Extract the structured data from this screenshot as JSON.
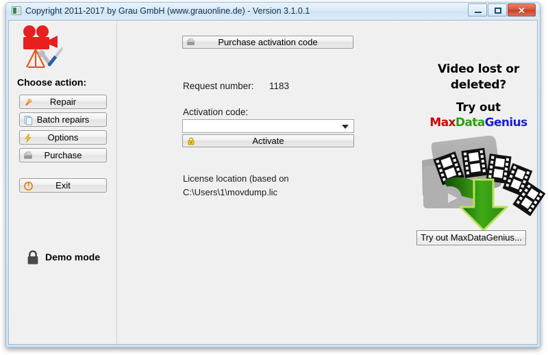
{
  "window": {
    "title": "Copyright 2011-2017 by Grau GmbH (www.grauonline.de) - Version 3.1.0.1",
    "app_icon": "app-icon",
    "controls": {
      "minimize": "minimize-button",
      "maximize": "maximize-button",
      "close_glyph": "✕"
    }
  },
  "sidebar": {
    "logo_icon": "movie-camera-repair-icon",
    "choose_label": "Choose action:",
    "buttons": [
      {
        "label": "Repair",
        "icon": "wrench-icon"
      },
      {
        "label": "Batch repairs",
        "icon": "documents-icon"
      },
      {
        "label": "Options",
        "icon": "lightning-icon"
      },
      {
        "label": "Purchase",
        "icon": "cart-icon"
      },
      {
        "label": "Exit",
        "icon": "power-icon"
      }
    ],
    "status": {
      "icon": "padlock-icon",
      "label": "Demo mode"
    }
  },
  "main": {
    "purchase_code_button": {
      "label": "Purchase activation code",
      "icon": "cart-icon"
    },
    "request_number_label": "Request number:",
    "request_number_value": "1183",
    "activation_code_label": "Activation code:",
    "activation_code_value": "",
    "activation_code_placeholder": "",
    "combo_arrow_icon": "chevron-down-icon",
    "activate_button": {
      "label": "Activate",
      "icon": "padlock-gold-icon"
    },
    "license_line1": "License location (based on",
    "license_line2": "C:\\Users\\1\\movdump.lic"
  },
  "promo": {
    "headline_line1": "Video lost or",
    "headline_line2": "deleted?",
    "try_out": "Try out",
    "brand_part1": "Max",
    "brand_part2": "Data",
    "brand_part3": "Genius",
    "art_icon": "film-strips-recovery-icon",
    "button_label": "Try out MaxDataGenius..."
  },
  "colors": {
    "brand_red": "#cc0000",
    "brand_green": "#2f9e12",
    "brand_blue": "#1a20cc",
    "titlebar": "#d6e8f7",
    "client_bg": "#f0f0f0",
    "close_button": "#c33f27"
  }
}
